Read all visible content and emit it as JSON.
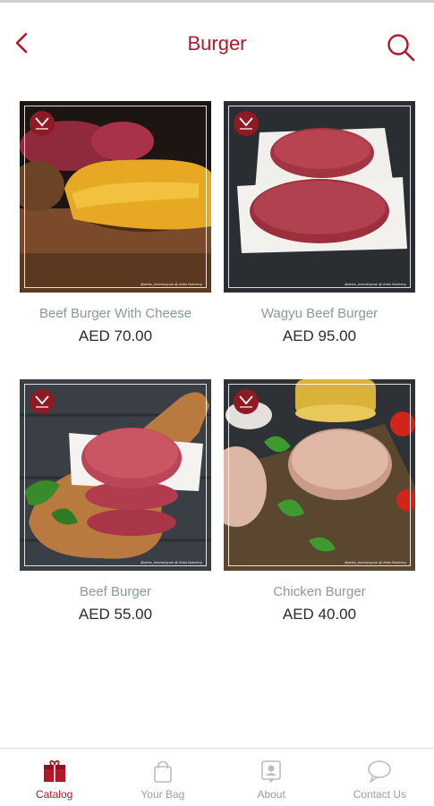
{
  "header": {
    "title": "Burger"
  },
  "products": [
    {
      "name": "Beef Burger With Cheese",
      "price": "AED 70.00",
      "image_icon": "cheese-burger-patty-photo"
    },
    {
      "name": "Wagyu Beef Burger",
      "price": "AED 95.00",
      "image_icon": "wagyu-patties-photo"
    },
    {
      "name": "Beef Burger",
      "price": "AED 55.00",
      "image_icon": "stacked-raw-patties-photo"
    },
    {
      "name": "Chicken Burger",
      "price": "AED 40.00",
      "image_icon": "chicken-patties-photo"
    }
  ],
  "photo_credit": "@ahbs_butcheryuae   @ Ahbs Butchery",
  "tabs": [
    {
      "label": "Catalog",
      "icon": "catalog-icon",
      "active": true
    },
    {
      "label": "Your Bag",
      "icon": "bag-icon",
      "active": false
    },
    {
      "label": "About",
      "icon": "about-icon",
      "active": false
    },
    {
      "label": "Contact Us",
      "icon": "chat-icon",
      "active": false
    }
  ],
  "colors": {
    "accent": "#b3172a",
    "muted_text": "#8a98a3",
    "price_text": "#2b2b2b",
    "tab_inactive": "#9aa0a6"
  }
}
